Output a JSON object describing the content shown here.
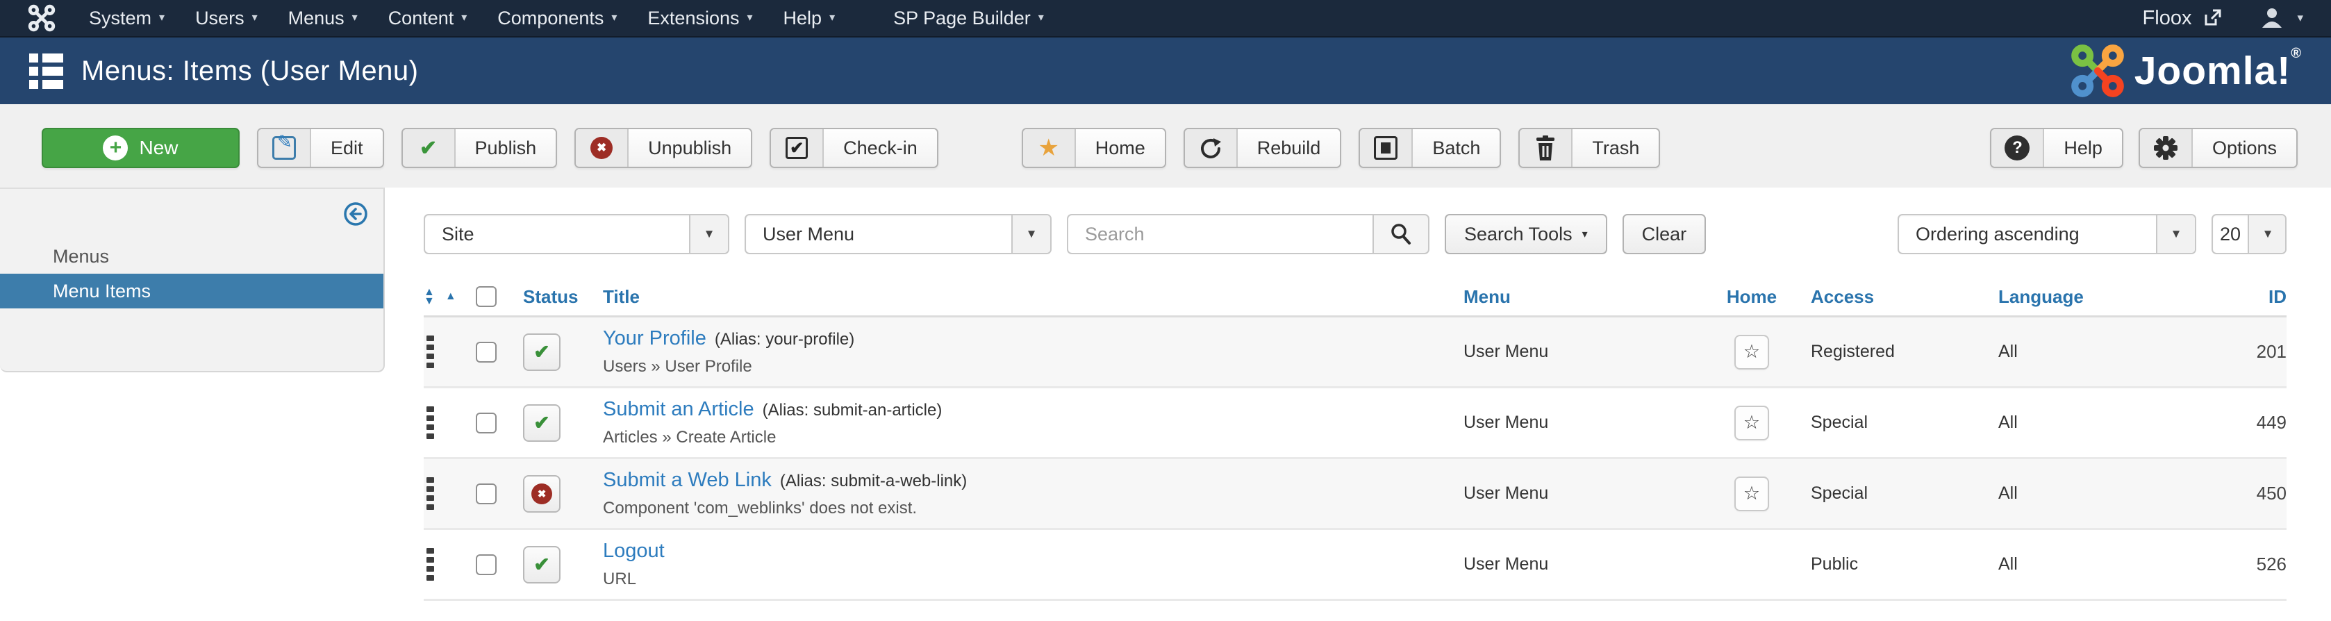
{
  "topbar": {
    "menus": [
      "System",
      "Users",
      "Menus",
      "Content",
      "Components",
      "Extensions",
      "Help",
      "SP Page Builder"
    ],
    "site_link": "Floox"
  },
  "titlebar": {
    "title": "Menus: Items (User Menu)",
    "logo_text": "Joomla!",
    "logo_reg": "®"
  },
  "toolbar": {
    "new": "New",
    "edit": "Edit",
    "publish": "Publish",
    "unpublish": "Unpublish",
    "checkin": "Check-in",
    "home": "Home",
    "rebuild": "Rebuild",
    "batch": "Batch",
    "trash": "Trash",
    "help": "Help",
    "options": "Options"
  },
  "sidebar": {
    "items": [
      {
        "label": "Menus",
        "active": false
      },
      {
        "label": "Menu Items",
        "active": true
      }
    ]
  },
  "filters": {
    "site": "Site",
    "menu": "User Menu",
    "search_placeholder": "Search",
    "search_tools": "Search Tools",
    "clear": "Clear",
    "ordering": "Ordering ascending",
    "limit": "20"
  },
  "table": {
    "columns": {
      "status": "Status",
      "title": "Title",
      "menu": "Menu",
      "home": "Home",
      "access": "Access",
      "language": "Language",
      "id": "ID"
    },
    "rows": [
      {
        "title": "Your Profile",
        "alias": "(Alias: your-profile)",
        "path": "Users » User Profile",
        "menu": "User Menu",
        "access": "Registered",
        "language": "All",
        "id": "201",
        "status": "published"
      },
      {
        "title": "Submit an Article",
        "alias": "(Alias: submit-an-article)",
        "path": "Articles » Create Article",
        "menu": "User Menu",
        "access": "Special",
        "language": "All",
        "id": "449",
        "status": "published"
      },
      {
        "title": "Submit a Web Link",
        "alias": "(Alias: submit-a-web-link)",
        "path": "Component 'com_weblinks' does not exist.",
        "menu": "User Menu",
        "access": "Special",
        "language": "All",
        "id": "450",
        "status": "unpublished"
      },
      {
        "title": "Logout",
        "alias": "",
        "path": "URL",
        "menu": "User Menu",
        "access": "Public",
        "language": "All",
        "id": "526",
        "status": "published"
      }
    ]
  },
  "icons": {
    "caret_down": "▾",
    "triangle_up": "▲",
    "triangle_down": "▼",
    "check": "✔",
    "cross": "✖",
    "star_filled": "★",
    "star_outline": "☆",
    "plus": "+",
    "question": "?"
  },
  "colors": {
    "topbar_bg": "#1b293c",
    "titlebar_bg": "#25456e",
    "accent_blue": "#2d7cbe",
    "sidebar_active": "#3d7dab",
    "success_green": "#46a546",
    "danger_red": "#9d2d25",
    "star_orange": "#e8a33d"
  }
}
